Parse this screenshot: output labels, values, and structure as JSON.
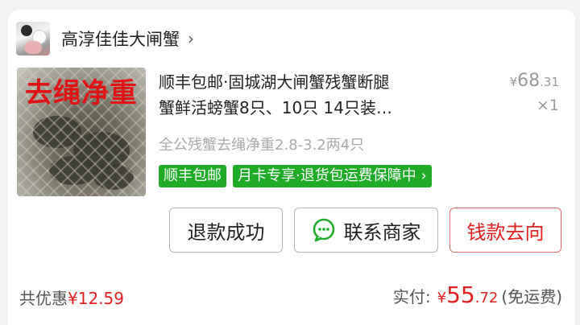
{
  "store": {
    "name": "高淳佳佳大闸蟹",
    "chevron": "›"
  },
  "product": {
    "image_label": "去绳净重",
    "title_line1": "顺丰包邮·固城湖大闸蟹残蟹断腿",
    "title_line2": "蟹鲜活螃蟹8只、10只 14只装…",
    "price_symbol": "¥",
    "price_int": "68",
    "price_dec": ".31",
    "quantity": "×1",
    "spec": "全公残蟹去绳净重2.8-3.2两4只",
    "tags": [
      "顺丰包邮",
      "月卡专享·退货包运费保障中 ›"
    ]
  },
  "actions": {
    "refund": "退款成功",
    "contact": "联系商家",
    "money_flow": "钱款去向"
  },
  "summary": {
    "discount_label": "共优惠",
    "discount_amount": "¥12.59",
    "paid_label": "实付:",
    "paid_symbol": "¥",
    "paid_int": "55",
    "paid_dec": ".72",
    "paid_note": "(免运费)"
  },
  "colors": {
    "accent_green": "#1faa27",
    "accent_red": "#e02020"
  },
  "icons": {
    "chat": "chat-bubble-icon"
  }
}
